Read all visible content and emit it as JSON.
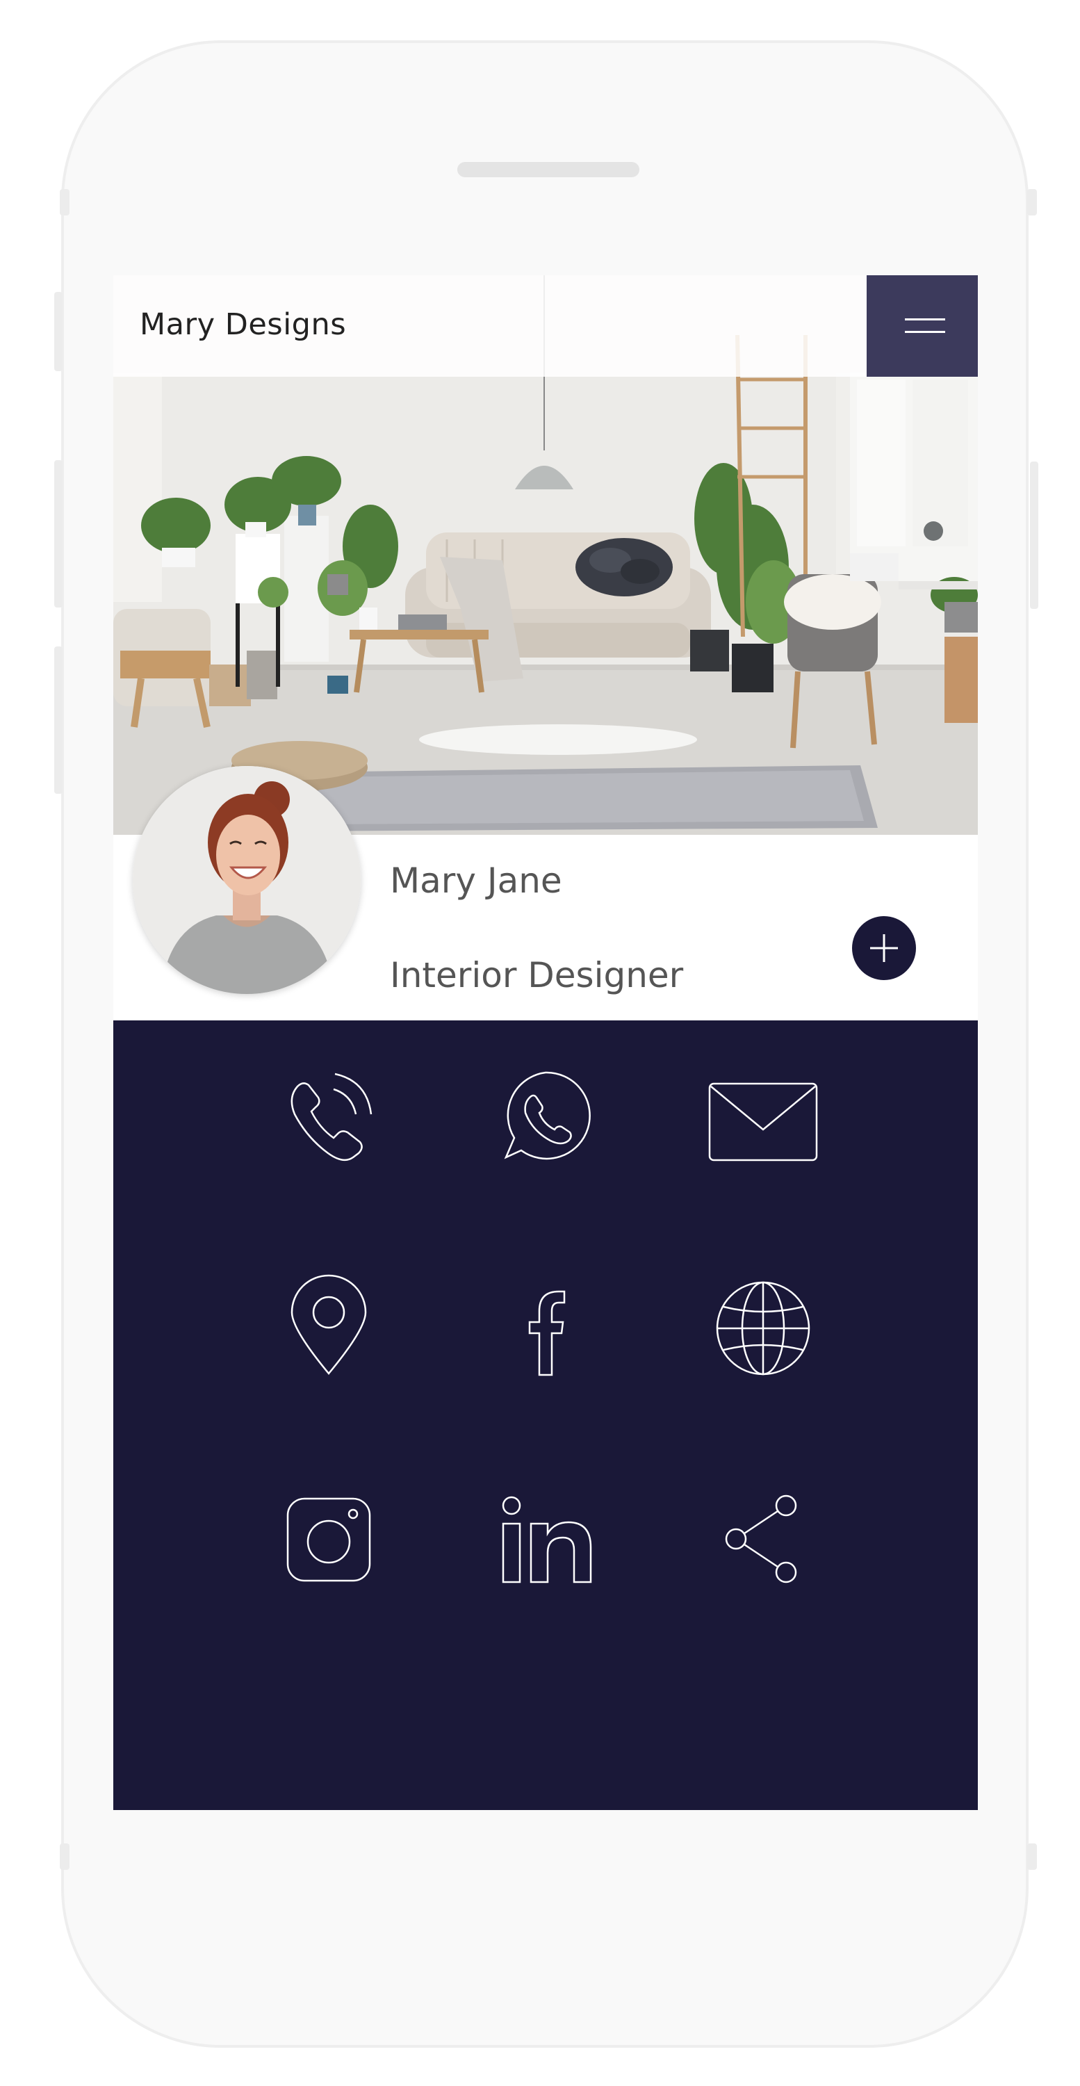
{
  "header": {
    "brand": "Mary Designs",
    "menu_icon": "hamburger-icon"
  },
  "profile": {
    "name": "Mary Jane",
    "title": "Interior Designer",
    "add_icon": "plus-icon"
  },
  "contacts": [
    {
      "id": "phone",
      "icon": "phone-icon"
    },
    {
      "id": "whatsapp",
      "icon": "whatsapp-icon"
    },
    {
      "id": "email",
      "icon": "mail-icon"
    },
    {
      "id": "location",
      "icon": "location-pin-icon"
    },
    {
      "id": "facebook",
      "icon": "facebook-icon"
    },
    {
      "id": "website",
      "icon": "globe-icon"
    },
    {
      "id": "instagram",
      "icon": "instagram-icon"
    },
    {
      "id": "linkedin",
      "icon": "linkedin-icon"
    },
    {
      "id": "share",
      "icon": "share-icon"
    }
  ],
  "colors": {
    "navy": "#1a1838",
    "menu_bg": "#3c3a5c",
    "text": "#555555",
    "phone_shell": "#f9f9f9"
  }
}
